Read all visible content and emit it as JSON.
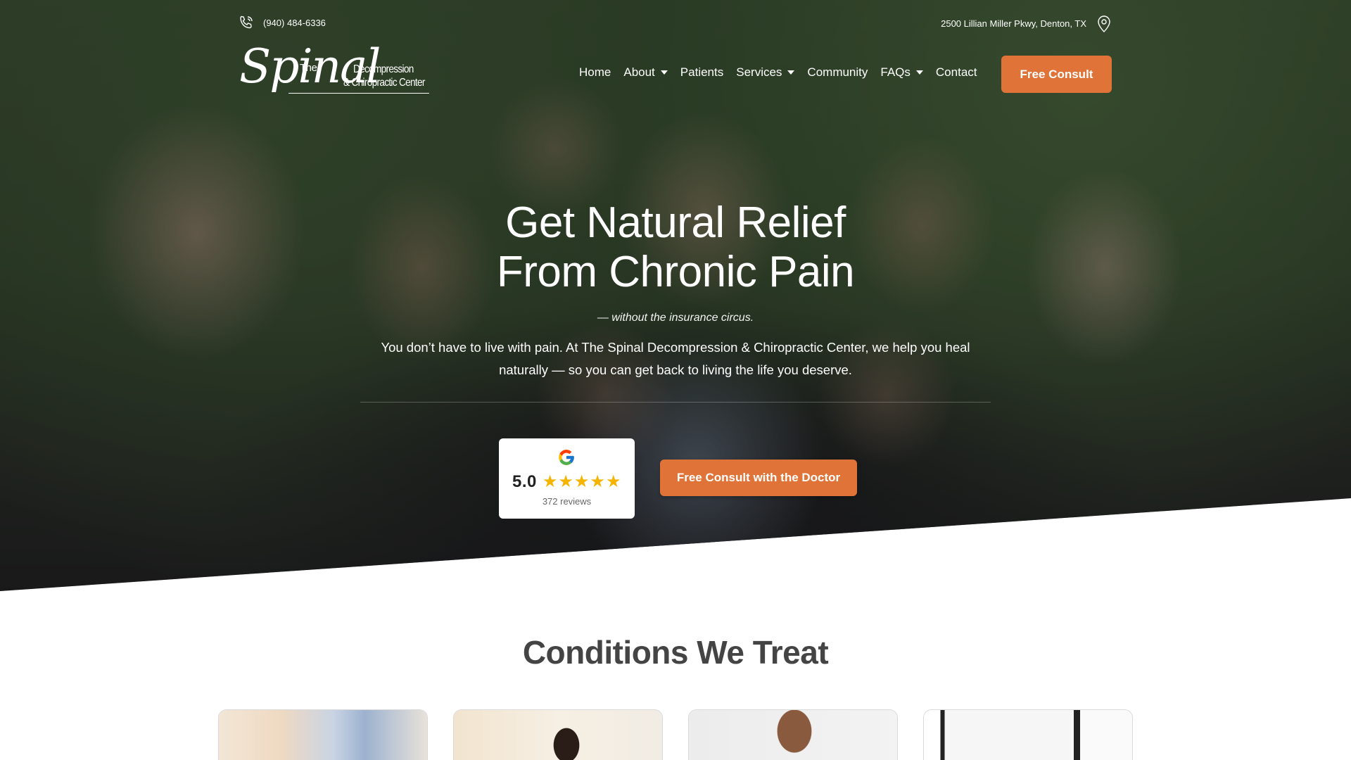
{
  "topbar": {
    "phone": "(940) 484-6336",
    "phone_icon": "phone-icon",
    "address": "2500 Lillian Miller Pkwy, Denton, TX",
    "address_icon": "map-pin-icon"
  },
  "logo": {
    "script": "Spinal",
    "the": "The",
    "line1": "Decompression",
    "line2": "& Chiropractic Center"
  },
  "nav": {
    "items": [
      {
        "label": "Home",
        "has_dropdown": false
      },
      {
        "label": "About",
        "has_dropdown": true
      },
      {
        "label": "Patients",
        "has_dropdown": false
      },
      {
        "label": "Services",
        "has_dropdown": true
      },
      {
        "label": "Community",
        "has_dropdown": false
      },
      {
        "label": "FAQs",
        "has_dropdown": true
      },
      {
        "label": "Contact",
        "has_dropdown": false
      }
    ],
    "cta": "Free Consult"
  },
  "hero": {
    "headline_line1": "Get Natural Relief",
    "headline_line2": "From Chronic Pain",
    "tagline": "— without the insurance circus.",
    "subtext_line1": "You don’t have to live with pain. At The Spinal Decompression & Chiropractic Center, we help you heal",
    "subtext_line2": "naturally — so you can get back to living the life you deserve.",
    "cta": "Free Consult with the Doctor"
  },
  "reviews": {
    "rating": "5.0",
    "stars": 5,
    "count": "372 reviews",
    "source_icon": "google-icon"
  },
  "conditions": {
    "title": "Conditions We Treat",
    "cards": [
      {
        "name": "condition-card-1"
      },
      {
        "name": "condition-card-2"
      },
      {
        "name": "condition-card-3"
      },
      {
        "name": "condition-card-4"
      }
    ]
  },
  "colors": {
    "accent": "#e07438",
    "star": "#f4b400",
    "heading": "#444444"
  }
}
